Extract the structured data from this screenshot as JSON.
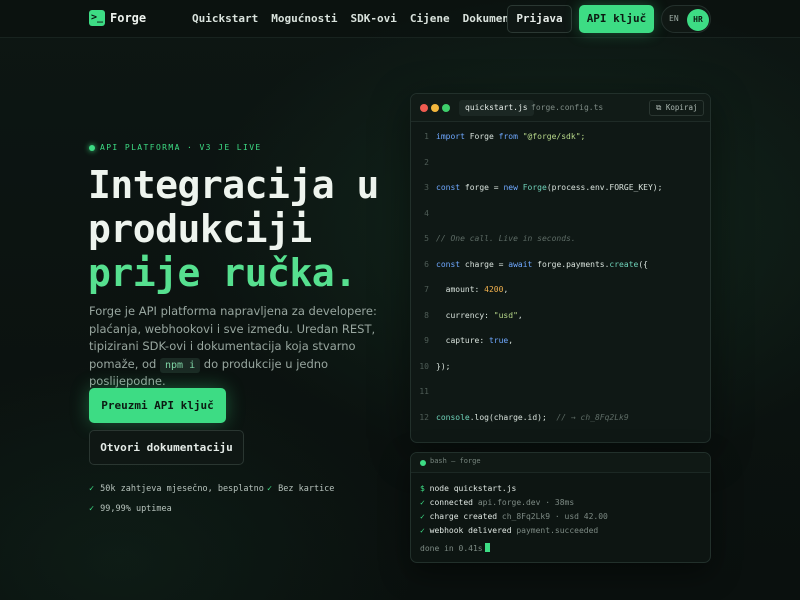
{
  "nav": {
    "brand_mark": ">_",
    "brand_name": "Forge",
    "links": [
      "Quickstart",
      "Mogućnosti",
      "SDK-ovi",
      "Cijene",
      "Dokumentacija"
    ],
    "login_label": "Prijava",
    "api_key_label": "API ključ",
    "lang_en": "EN",
    "lang_hr": "HR"
  },
  "hero": {
    "eyebrow": "API PLATFORMA · V3 JE LIVE",
    "headline_1": "Integracija u",
    "headline_2": "produkciji",
    "headline_3": "prije ručka.",
    "lede_before": "Forge je API platforma napravljena za developere: plaćanja, webhookovi i sve između. Uredan REST, tipizirani SDK-ovi i dokumentacija koja stvarno pomaže, od ",
    "lede_code": "npm i",
    "lede_after": " do produkcije u jedno poslijepodne.",
    "cta_primary": "Preuzmi API ključ",
    "cta_secondary": "Otvori dokumentaciju",
    "checks": [
      "50k zahtjeva mjesečno, besplatno",
      "Bez kartice",
      "99,99% uptimea"
    ]
  },
  "editor": {
    "tab_active": "quickstart.js",
    "tab_other": "forge.config.ts",
    "copy_label": "Kopiraj",
    "lines": {
      "l1": {
        "n": "1",
        "a": "import",
        "b": " Forge ",
        "c": "from",
        "d": " \"@forge/sdk\";"
      },
      "l2": {
        "n": "2"
      },
      "l3": {
        "n": "3",
        "a": "const",
        "b": " forge = ",
        "c": "new",
        "d": " Forge",
        "e": "(process.env.FORGE_KEY);"
      },
      "l4": {
        "n": "4"
      },
      "l5": {
        "n": "5",
        "a": "// One call. Live in seconds."
      },
      "l6": {
        "n": "6",
        "a": "const",
        "b": " charge = ",
        "c": "await",
        "d": " forge.payments.",
        "e": "create",
        "f": "({"
      },
      "l7": {
        "n": "7",
        "a": "  amount: ",
        "b": "4200",
        "c": ","
      },
      "l8": {
        "n": "8",
        "a": "  currency: ",
        "b": "\"usd\"",
        "c": ","
      },
      "l9": {
        "n": "9",
        "a": "  capture: ",
        "b": "true",
        "c": ","
      },
      "l10": {
        "n": "10",
        "a": "});"
      },
      "l11": {
        "n": "11"
      },
      "l12": {
        "n": "12",
        "a": "console",
        "b": ".log(charge.id);",
        "c": "  // → ch_8Fq2Lk9"
      }
    }
  },
  "terminal": {
    "title": "bash — forge",
    "prompt": "$",
    "command": " node quickstart.js",
    "tick": "✓",
    "out1_label": " connected",
    "out1_dim": " api.forge.dev · 38ms",
    "out2_label": " charge created",
    "out2_dim": " ch_8Fq2Lk9 · usd 42.00",
    "out3_label": " webhook delivered",
    "out3_dim": " payment.succeeded",
    "done": "done in 0.41s"
  },
  "colors": {
    "accent": "#3ddc84",
    "background": "#0b1210",
    "keyword": "#6fa8ff",
    "string": "#b8d98a",
    "number": "#f0b04d"
  }
}
